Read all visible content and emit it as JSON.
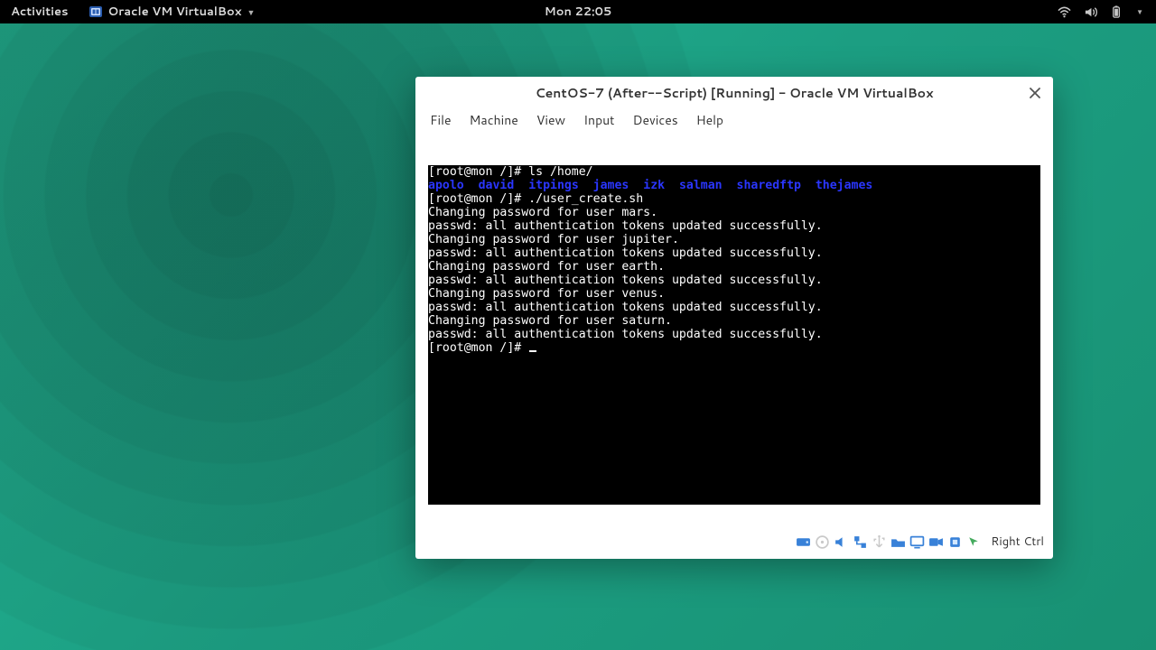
{
  "topbar": {
    "activities": "Activities",
    "app_name": "Oracle VM VirtualBox",
    "clock": "Mon 22:05"
  },
  "window": {
    "title": "CentOS-7 (After--Script) [Running] - Oracle VM VirtualBox",
    "menus": [
      "File",
      "Machine",
      "View",
      "Input",
      "Devices",
      "Help"
    ],
    "hostkey": "Right Ctrl"
  },
  "terminal": {
    "prompt": "[root@mon /]# ",
    "cmd1": "ls /home/",
    "dirs": [
      "apolo",
      "david",
      "itpings",
      "james",
      "izk",
      "salman",
      "sharedftp",
      "thejames"
    ],
    "cmd2": "./user_create.sh",
    "output": [
      "Changing password for user mars.",
      "passwd: all authentication tokens updated successfully.",
      "Changing password for user jupiter.",
      "passwd: all authentication tokens updated successfully.",
      "Changing password for user earth.",
      "passwd: all authentication tokens updated successfully.",
      "Changing password for user venus.",
      "passwd: all authentication tokens updated successfully.",
      "Changing password for user saturn.",
      "passwd: all authentication tokens updated successfully."
    ]
  }
}
